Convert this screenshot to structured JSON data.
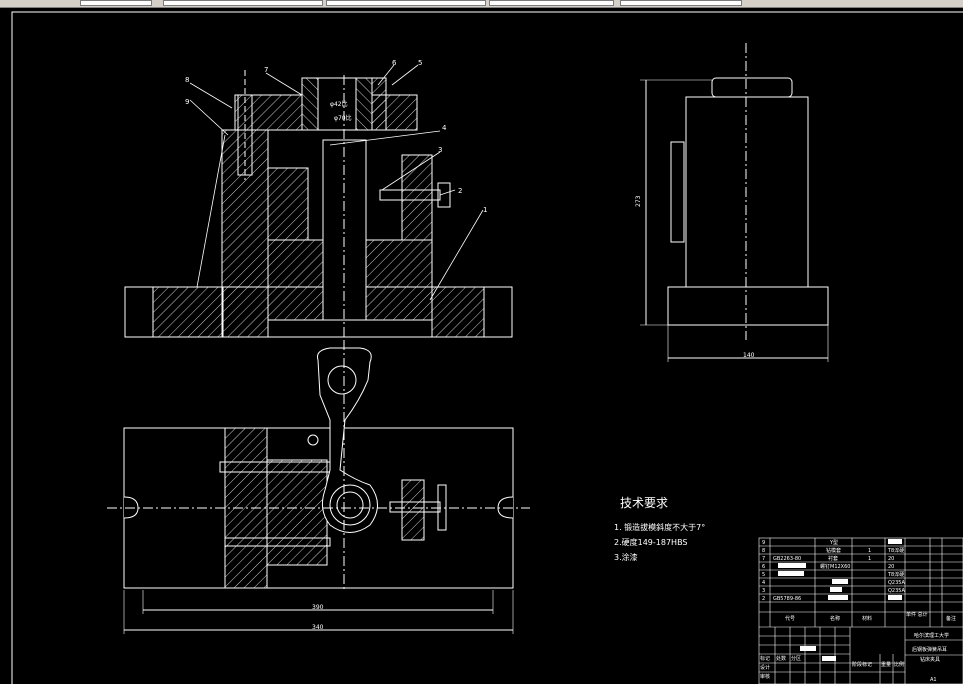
{
  "colors": {
    "background": "#000000",
    "lines": "#ffffff",
    "toolbar": "#d4d0c8",
    "label_lines": "#ffffff"
  },
  "front_view": {
    "callouts": [
      "8",
      "9",
      "7",
      "6",
      "5",
      "4",
      "3",
      "2",
      "1"
    ],
    "dim_bore": "φ70比",
    "dim_inner": "φ42比"
  },
  "side_view": {
    "dim_height": "273",
    "dim_width": "140"
  },
  "top_view": {
    "dim_inner_width": "390",
    "dim_total_width": "340"
  },
  "tech_req": {
    "title": "技术要求",
    "items": [
      "1. 锻造拔模斜度不大于7°",
      "2.硬度149-187HBS",
      "3.涂漆"
    ]
  },
  "bom": {
    "rows": [
      [
        "9",
        "",
        "",
        "Y型",
        "",
        "",
        "",
        ""
      ],
      [
        "8",
        "",
        "",
        "钻模套",
        "1",
        "T8淬硬",
        "",
        ""
      ],
      [
        "7",
        "GB2263-80",
        "",
        "衬套",
        "1",
        "20",
        "",
        ""
      ],
      [
        "6",
        "",
        "",
        "螺钉M12X60",
        "1",
        "20",
        "",
        ""
      ],
      [
        "5",
        "",
        "",
        "",
        "1",
        "T8淬硬",
        "",
        ""
      ],
      [
        "4",
        "",
        "",
        "",
        "1",
        "Q235A",
        "",
        ""
      ],
      [
        "3",
        "",
        "",
        "",
        "1",
        "Q235A",
        "",
        ""
      ],
      [
        "2",
        "GB5789-86",
        "",
        "",
        "1",
        "",
        "",
        ""
      ]
    ],
    "header": [
      "代号",
      "名称",
      "材料",
      "单件 总计",
      "备注"
    ],
    "school": "哈尔滨理工大学",
    "title1": "后钢板弹簧吊耳",
    "title2": "钻床夹具",
    "sheet": "A1",
    "signature_labels": [
      "标记",
      "处数",
      "分区",
      "更改",
      "签名",
      "年月日",
      "设计",
      "审核",
      "工艺",
      "批准"
    ],
    "stage_labels": [
      "阶段标记",
      "重量",
      "比例"
    ],
    "sheet_labels": [
      "共 张",
      "第 张"
    ]
  }
}
